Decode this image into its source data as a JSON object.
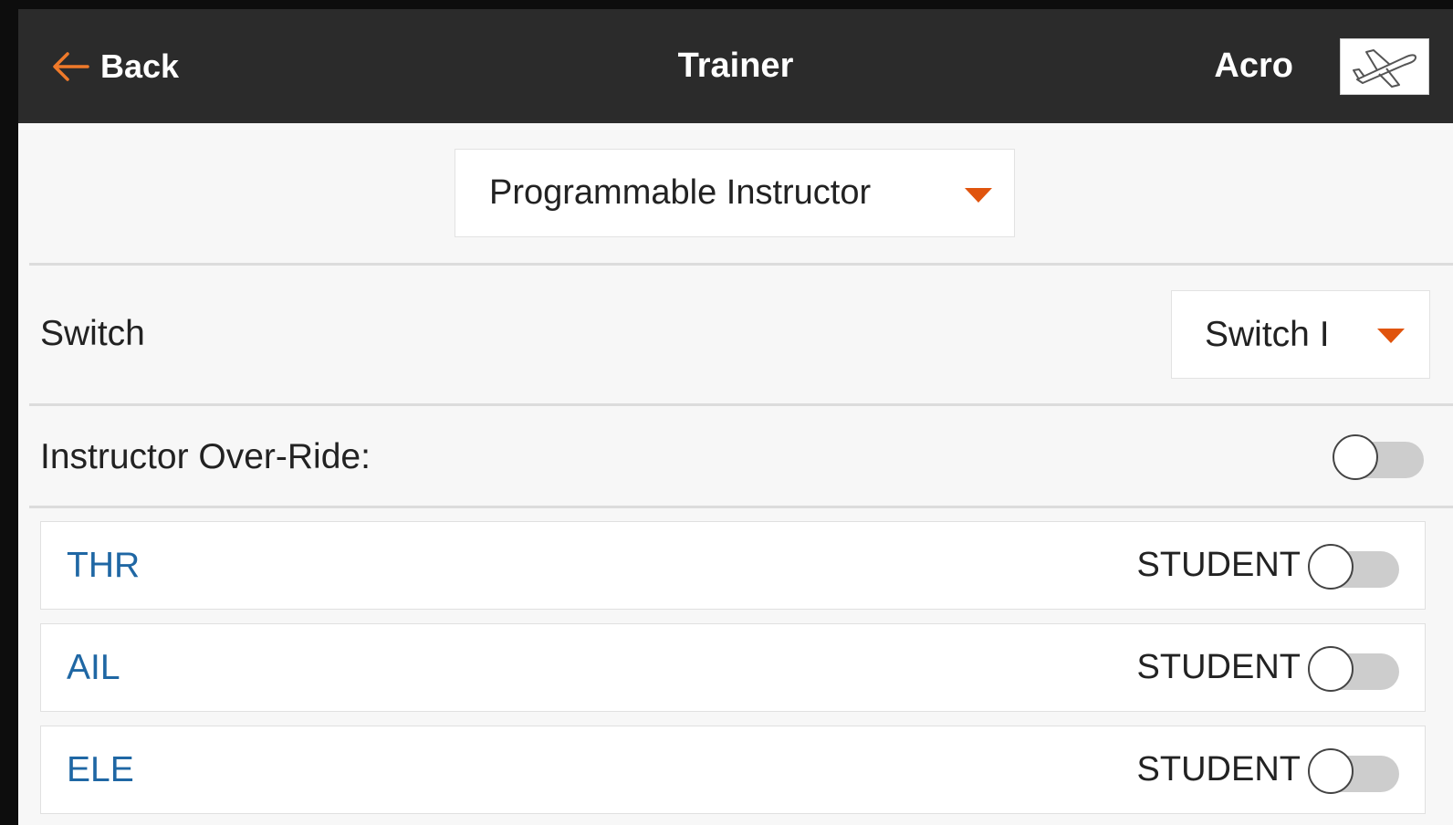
{
  "header": {
    "back_label": "Back",
    "title": "Trainer",
    "model_name": "Acro",
    "model_icon": "airplane-icon"
  },
  "mode_select": {
    "value": "Programmable Instructor"
  },
  "switch_row": {
    "label": "Switch",
    "value": "Switch I"
  },
  "override_row": {
    "label": "Instructor Over-Ride:",
    "enabled": false
  },
  "channels": [
    {
      "name": "THR",
      "state": "STUDENT",
      "enabled": false
    },
    {
      "name": "AIL",
      "state": "STUDENT",
      "enabled": false
    },
    {
      "name": "ELE",
      "state": "STUDENT",
      "enabled": false
    }
  ],
  "colors": {
    "header_bg": "#2b2b2b",
    "accent": "#e0540d",
    "channel_text": "#1f67a4",
    "background": "#f7f7f7"
  }
}
